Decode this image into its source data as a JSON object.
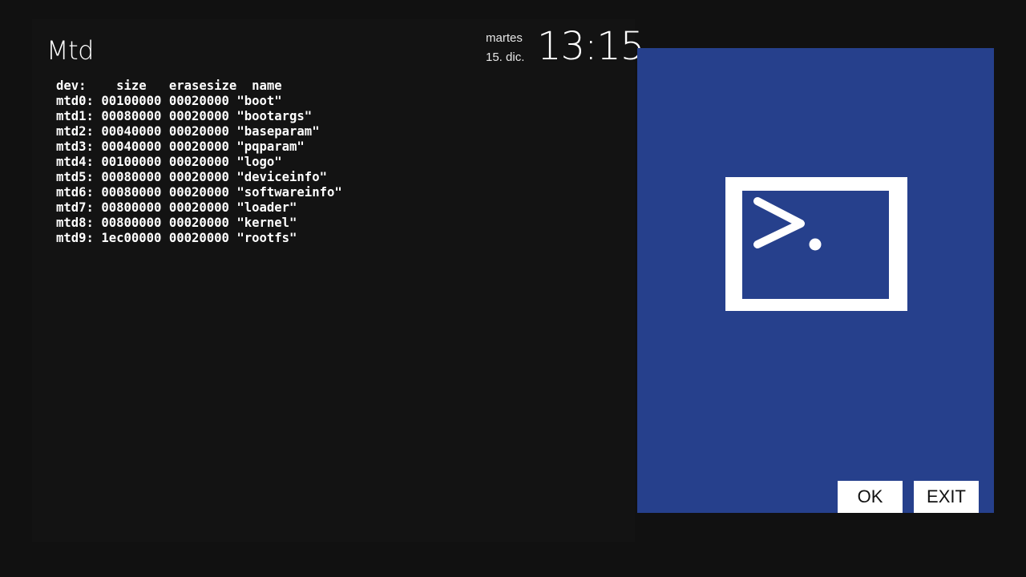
{
  "window": {
    "title": "Mtd"
  },
  "status": {
    "day": "martes",
    "date": "15. dic.",
    "time": "13:15"
  },
  "terminal": {
    "lines": [
      "dev:    size   erasesize  name",
      "mtd0: 00100000 00020000 \"boot\"",
      "mtd1: 00080000 00020000 \"bootargs\"",
      "mtd2: 00040000 00020000 \"baseparam\"",
      "mtd3: 00040000 00020000 \"pqparam\"",
      "mtd4: 00100000 00020000 \"logo\"",
      "mtd5: 00080000 00020000 \"deviceinfo\"",
      "mtd6: 00080000 00020000 \"softwareinfo\"",
      "mtd7: 00800000 00020000 \"loader\"",
      "mtd8: 00800000 00020000 \"kernel\"",
      "mtd9: 1ec00000 00020000 \"rootfs\""
    ]
  },
  "side_panel": {
    "icon": "terminal-prompt-icon",
    "accent_color": "#26408c",
    "ok_label": "OK",
    "exit_label": "EXIT"
  }
}
